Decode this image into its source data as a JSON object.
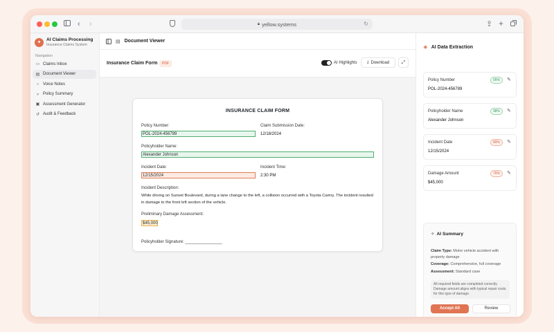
{
  "browser": {
    "url": "yellow.systems"
  },
  "sidebar": {
    "title": "AI Claims Processing",
    "subtitle": "Insurance Claims System",
    "nav_heading": "Navigation",
    "items": [
      {
        "label": "Claims Inbox",
        "icon": "inbox-icon"
      },
      {
        "label": "Document Viewer",
        "icon": "document-icon"
      },
      {
        "label": "Voice Notes",
        "icon": "microphone-icon"
      },
      {
        "label": "Policy Summary",
        "icon": "shield-icon"
      },
      {
        "label": "Assessment Generator",
        "icon": "clipboard-icon"
      },
      {
        "label": "Audit & Feedback",
        "icon": "history-icon"
      }
    ]
  },
  "main": {
    "header": "Document Viewer",
    "doc_name": "Insurance Claim Form",
    "doc_badge": "PDF",
    "highlights_label": "AI Highlights",
    "download_label": "Download"
  },
  "form": {
    "title": "INSURANCE CLAIM FORM",
    "policy_number_label": "Policy Number:",
    "policy_number": "POL-2024-456789",
    "submission_date_label": "Claim Submission Date:",
    "submission_date": "12/18/2024",
    "holder_name_label": "Policyholder Name:",
    "holder_name": "Alexander Johnson",
    "incident_date_label": "Incident Date:",
    "incident_date": "12/15/2024",
    "incident_time_label": "Incident Time:",
    "incident_time": "2:30 PM",
    "description_label": "Incident Description:",
    "description": "While driving on Sunset Boulevard, during a lane change to the left, a collision occurred with a Toyota Camry. The incident resulted in damage to the front left section of the vehicle.",
    "damage_label": "Preliminary Damage Assessment:",
    "damage": "$45,000",
    "signature_label": "Policyholder Signature: ________________"
  },
  "extraction": {
    "title": "AI Data Extraction",
    "fields": [
      {
        "label": "Policy Number",
        "confidence": "95%",
        "value": "POL-2024-456789",
        "status": "high"
      },
      {
        "label": "Policyholder Name",
        "confidence": "98%",
        "value": "Alexander Johnson",
        "status": "high"
      },
      {
        "label": "Incident Date",
        "confidence": "89%",
        "value": "12/15/2024",
        "status": "medium"
      },
      {
        "label": "Damage Amount",
        "confidence": "76%",
        "value": "$45,000",
        "status": "medium"
      }
    ]
  },
  "summary": {
    "title": "AI Summary",
    "claim_type_label": "Claim Type:",
    "claim_type": "Motor vehicle accident with property damage",
    "coverage_label": "Coverage:",
    "coverage": "Comprehensive, full coverage",
    "assessment_label": "Assessment:",
    "assessment": "Standard case",
    "note": "All required fields are completed correctly. Damage amount aligns with typical repair costs for this type of damage.",
    "accept_label": "Accept All",
    "review_label": "Review"
  },
  "colors": {
    "accent": "#e07453",
    "high_confidence": "#3a9a5e",
    "medium_confidence": "#d26040"
  }
}
